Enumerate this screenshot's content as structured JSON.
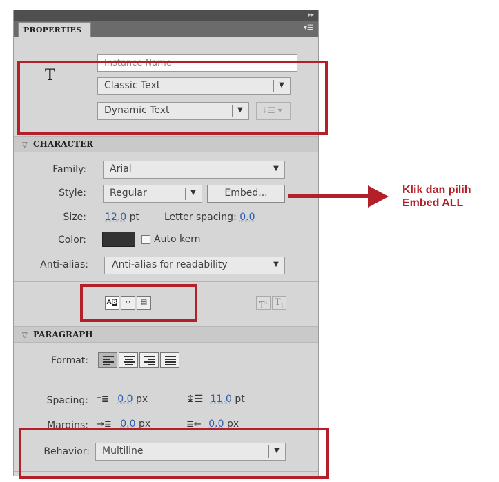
{
  "panel": {
    "tab_label": "PROPERTIES",
    "instance_name_placeholder": "Instance Name",
    "text_tool_glyph": "T",
    "text_engine": "Classic Text",
    "text_type": "Dynamic Text"
  },
  "character": {
    "header": "CHARACTER",
    "family_label": "Family:",
    "family_value": "Arial",
    "style_label": "Style:",
    "style_value": "Regular",
    "embed_label": "Embed...",
    "size_label": "Size:",
    "size_value": "12.0",
    "size_unit": "pt",
    "letter_spacing_label": "Letter spacing:",
    "letter_spacing_value": "0.0",
    "color_label": "Color:",
    "color_swatch": "#333333",
    "auto_kern_label": "Auto kern",
    "anti_alias_label": "Anti-alias:",
    "anti_alias_value": "Anti-alias for readability"
  },
  "paragraph": {
    "header": "PARAGRAPH",
    "format_label": "Format:",
    "spacing_label": "Spacing:",
    "indent_value": "0.0",
    "indent_unit": "px",
    "line_spacing_value": "11.0",
    "line_spacing_unit": "pt",
    "margins_label": "Margins:",
    "left_margin_value": "0.0",
    "left_margin_unit": "px",
    "right_margin_value": "0.0",
    "right_margin_unit": "px",
    "behavior_label": "Behavior:",
    "behavior_value": "Multiline"
  },
  "annotation": {
    "line1": "Klik dan pilih",
    "line2": "Embed ALL",
    "color": "#b3202a"
  },
  "icons": [
    "collapse-icon",
    "panel-menu-icon",
    "text-tool-icon",
    "chevron-down-icon",
    "text-orientation-icon",
    "triangle-down-icon",
    "selectable-text-icon",
    "render-html-icon",
    "show-border-icon",
    "superscript-icon",
    "subscript-icon",
    "align-left-icon",
    "align-center-icon",
    "align-right-icon",
    "justify-icon",
    "indent-icon",
    "line-spacing-icon",
    "left-margin-icon",
    "right-margin-icon",
    "arrow-right-icon"
  ]
}
